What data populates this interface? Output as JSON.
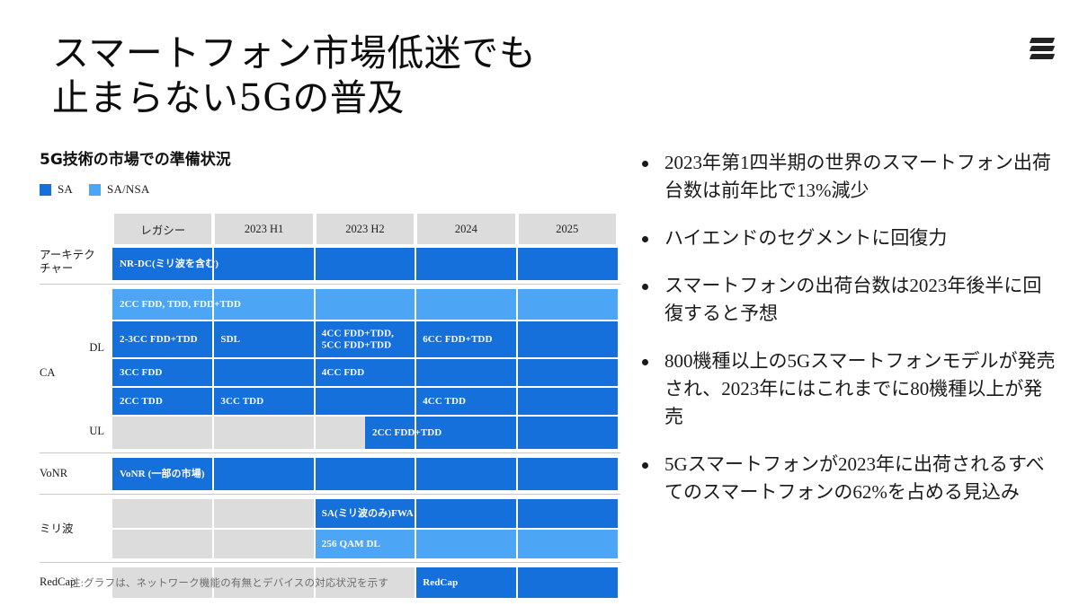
{
  "brand": {
    "logo_name": "ericsson-logo",
    "dark_blue": "#1570dc",
    "light_blue": "#4da6f5",
    "band_gray": "#dcdcdc"
  },
  "title": {
    "line1": "スマートフォン市場低迷でも",
    "line2": "止まらない5Gの普及"
  },
  "subtitle": "5G技術の市場での準備状況",
  "legend": [
    {
      "label": "SA",
      "color": "#1570dc"
    },
    {
      "label": "SA/NSA",
      "color": "#4da6f5"
    }
  ],
  "note": "注:グラフは、ネットワーク機能の有無とデバイスの対応状況を示す",
  "chart_data": {
    "type": "table",
    "title": "5G技術の市場での準備状況",
    "grid": true,
    "legend_position": "top-left",
    "categories": [
      "レガシー",
      "2023 H1",
      "2023 H2",
      "2024",
      "2025"
    ],
    "group_labels": [
      "アーキテクチャー",
      "CA",
      "VoNR",
      "ミリ波",
      "RedCap"
    ],
    "sub_labels": [
      "DL",
      "UL"
    ],
    "rows": [
      {
        "group": "アーキテクチャー",
        "sub": "",
        "bars": [
          {
            "start": 0,
            "end": 5,
            "color": "#1570dc",
            "series": "SA",
            "labels": [
              {
                "at": 0,
                "text": "NR-DC(ミリ波を含む)"
              }
            ]
          }
        ]
      },
      {
        "group": "CA",
        "sub": "DL",
        "bars": [
          {
            "start": 0,
            "end": 5,
            "color": "#4da6f5",
            "series": "SA/NSA",
            "labels": [
              {
                "at": 0,
                "text": "2CC FDD, TDD, FDD+TDD"
              }
            ]
          }
        ]
      },
      {
        "group": "CA",
        "sub": "DL",
        "bars": [
          {
            "start": 0,
            "end": 5,
            "color": "#1570dc",
            "series": "SA",
            "labels": [
              {
                "at": 0,
                "text": "2-3CC FDD+TDD"
              },
              {
                "at": 1,
                "text": "SDL"
              },
              {
                "at": 2,
                "text": "4CC FDD+TDD,\n5CC FDD+TDD"
              },
              {
                "at": 3,
                "text": "6CC FDD+TDD"
              }
            ]
          }
        ]
      },
      {
        "group": "CA",
        "sub": "DL",
        "bars": [
          {
            "start": 0,
            "end": 5,
            "color": "#1570dc",
            "series": "SA",
            "labels": [
              {
                "at": 0,
                "text": "3CC FDD"
              },
              {
                "at": 2,
                "text": "4CC FDD"
              }
            ]
          }
        ]
      },
      {
        "group": "CA",
        "sub": "DL",
        "bars": [
          {
            "start": 0,
            "end": 5,
            "color": "#1570dc",
            "series": "SA",
            "labels": [
              {
                "at": 0,
                "text": "2CC TDD"
              },
              {
                "at": 1,
                "text": "3CC TDD"
              },
              {
                "at": 3,
                "text": "4CC TDD"
              }
            ]
          }
        ]
      },
      {
        "group": "CA",
        "sub": "UL",
        "bars": [
          {
            "start": 2.5,
            "end": 5,
            "color": "#1570dc",
            "series": "SA",
            "labels": [
              {
                "at": 2.5,
                "text": "2CC FDD+TDD"
              }
            ]
          }
        ]
      },
      {
        "group": "VoNR",
        "sub": "",
        "bars": [
          {
            "start": 0,
            "end": 5,
            "color": "#1570dc",
            "series": "SA",
            "labels": [
              {
                "at": 0,
                "text": "VoNR (一部の市場)"
              }
            ]
          }
        ]
      },
      {
        "group": "ミリ波",
        "sub": "",
        "bars": [
          {
            "start": 2,
            "end": 5,
            "color": "#1570dc",
            "series": "SA",
            "labels": [
              {
                "at": 2,
                "text": "SA(ミリ波のみ)FWA"
              }
            ]
          }
        ]
      },
      {
        "group": "ミリ波",
        "sub": "",
        "bars": [
          {
            "start": 2,
            "end": 5,
            "color": "#4da6f5",
            "series": "SA/NSA",
            "labels": [
              {
                "at": 2,
                "text": "256 QAM DL"
              }
            ]
          }
        ]
      },
      {
        "group": "RedCap",
        "sub": "",
        "bars": [
          {
            "start": 3,
            "end": 5,
            "color": "#1570dc",
            "series": "SA",
            "labels": [
              {
                "at": 3,
                "text": "RedCap"
              }
            ]
          }
        ]
      }
    ]
  },
  "bullets": [
    "2023年第1四半期の世界のスマートフォン出荷台数は前年比で13%減少",
    "ハイエンドのセグメントに回復力",
    "スマートフォンの出荷台数は2023年後半に回復すると予想",
    "800機種以上の5Gスマートフォンモデルが発売され、2023年にはこれまでに80機種以上が発売",
    "5Gスマートフォンが2023年に出荷されるすべてのスマートフォンの62%を占める見込み"
  ]
}
